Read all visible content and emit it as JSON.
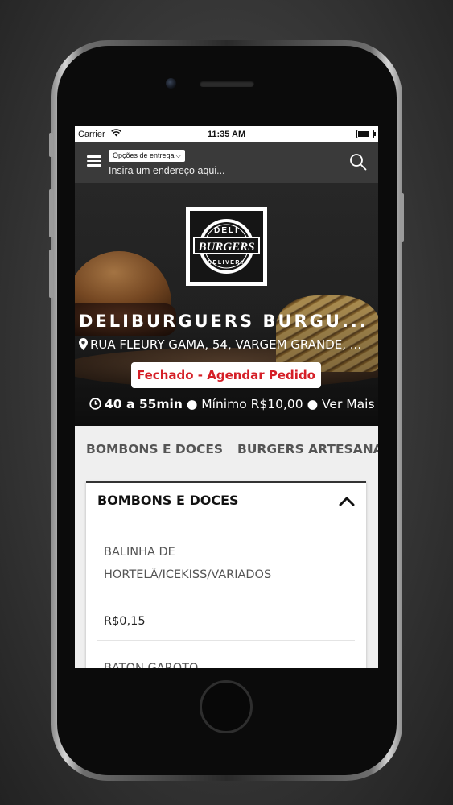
{
  "status_bar": {
    "carrier": "Carrier",
    "time": "11:35 AM",
    "battery_level": 0.9
  },
  "header": {
    "menu_icon": "hamburger-icon",
    "delivery_options_label": "Opções de entrega",
    "address_placeholder": "Insira um endereço aqui...",
    "search_icon": "search-icon"
  },
  "store": {
    "name": "DELIBURGUERS BURGU...",
    "address": "RUA FLEURY GAMA, 54, VARGEM GRANDE, ...",
    "status_button": "Fechado - Agendar Pedido",
    "delivery_time": "40 a 55min",
    "minimum": "Mínimo R$10,00",
    "see_more": "Ver Mais",
    "logo": {
      "top": "DELI",
      "main": "BURGERS",
      "bottom": "DELIVERY"
    }
  },
  "category_tabs": [
    {
      "label": "BOMBONS E DOCES"
    },
    {
      "label": "BURGERS ARTESANAIS"
    }
  ],
  "section": {
    "title": "BOMBONS E DOCES",
    "items": [
      {
        "name": "BALINHA DE HORTELÃ/ICEKISS/VARIADOS",
        "price": "R$0,15"
      },
      {
        "name": "BATON GAROTO",
        "price": ""
      }
    ]
  },
  "colors": {
    "header_bg": "#3a3a3a",
    "status_button_text": "#d51f27",
    "tabs_bg": "#efefef"
  }
}
